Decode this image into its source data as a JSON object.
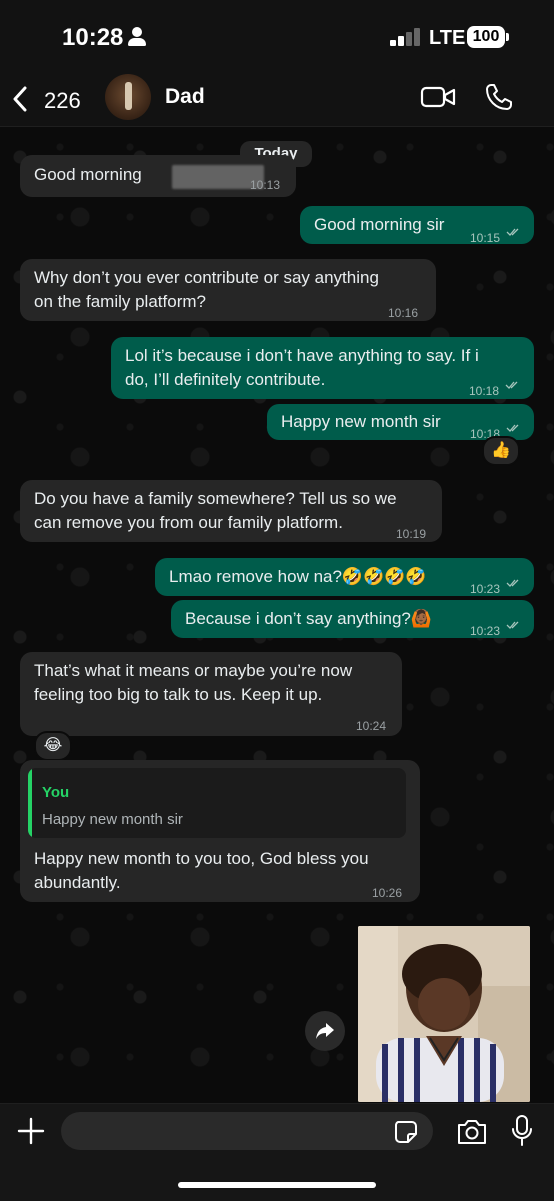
{
  "status_bar": {
    "time": "10:28",
    "network": "LTE",
    "battery": "100"
  },
  "header": {
    "back_count": "226",
    "contact_name": "Dad"
  },
  "date_separator": "Today",
  "messages": [
    {
      "dir": "in",
      "text": "Good morning",
      "time": "10:13"
    },
    {
      "dir": "out",
      "text": "Good morning sir",
      "time": "10:15"
    },
    {
      "dir": "in",
      "lines": [
        "Why don’t you ever contribute or say anything",
        "on the family platform?"
      ],
      "time": "10:16"
    },
    {
      "dir": "out",
      "lines": [
        "Lol it’s because i don’t have anything to say. If i",
        "do, I’ll definitely contribute."
      ],
      "time": "10:18"
    },
    {
      "dir": "out",
      "text": "Happy new month sir",
      "time": "10:18",
      "reaction": "👍"
    },
    {
      "dir": "in",
      "lines": [
        "Do you have a family somewhere? Tell us so we",
        "can remove you from our family platform."
      ],
      "time": "10:19"
    },
    {
      "dir": "out",
      "text": "Lmao remove how na?🤣🤣🤣🤣",
      "time": "10:23"
    },
    {
      "dir": "out",
      "text": "Because i don’t say anything?🙆🏾",
      "time": "10:23"
    },
    {
      "dir": "in",
      "lines": [
        "That’s what it means or maybe you’re now",
        "feeling too big to talk to us. Keep it up."
      ],
      "time": "10:24",
      "reaction": "😂"
    },
    {
      "dir": "in",
      "quote": {
        "author": "You",
        "text": "Happy new month sir"
      },
      "lines": [
        "Happy new month to you too, God bless you",
        "abundantly."
      ],
      "time": "10:26"
    }
  ],
  "composer": {
    "value": "",
    "placeholder": ""
  },
  "colors": {
    "incoming_bubble": "#262626",
    "outgoing_bubble": "#005c4b",
    "accent_green": "#25d366",
    "background": "#0b0b0b"
  },
  "icons": [
    "person-icon",
    "signal-icon",
    "back-chevron-icon",
    "video-call-icon",
    "phone-icon",
    "read-ticks-icon",
    "forward-icon",
    "plus-icon",
    "sticker-icon",
    "camera-icon",
    "mic-icon"
  ]
}
